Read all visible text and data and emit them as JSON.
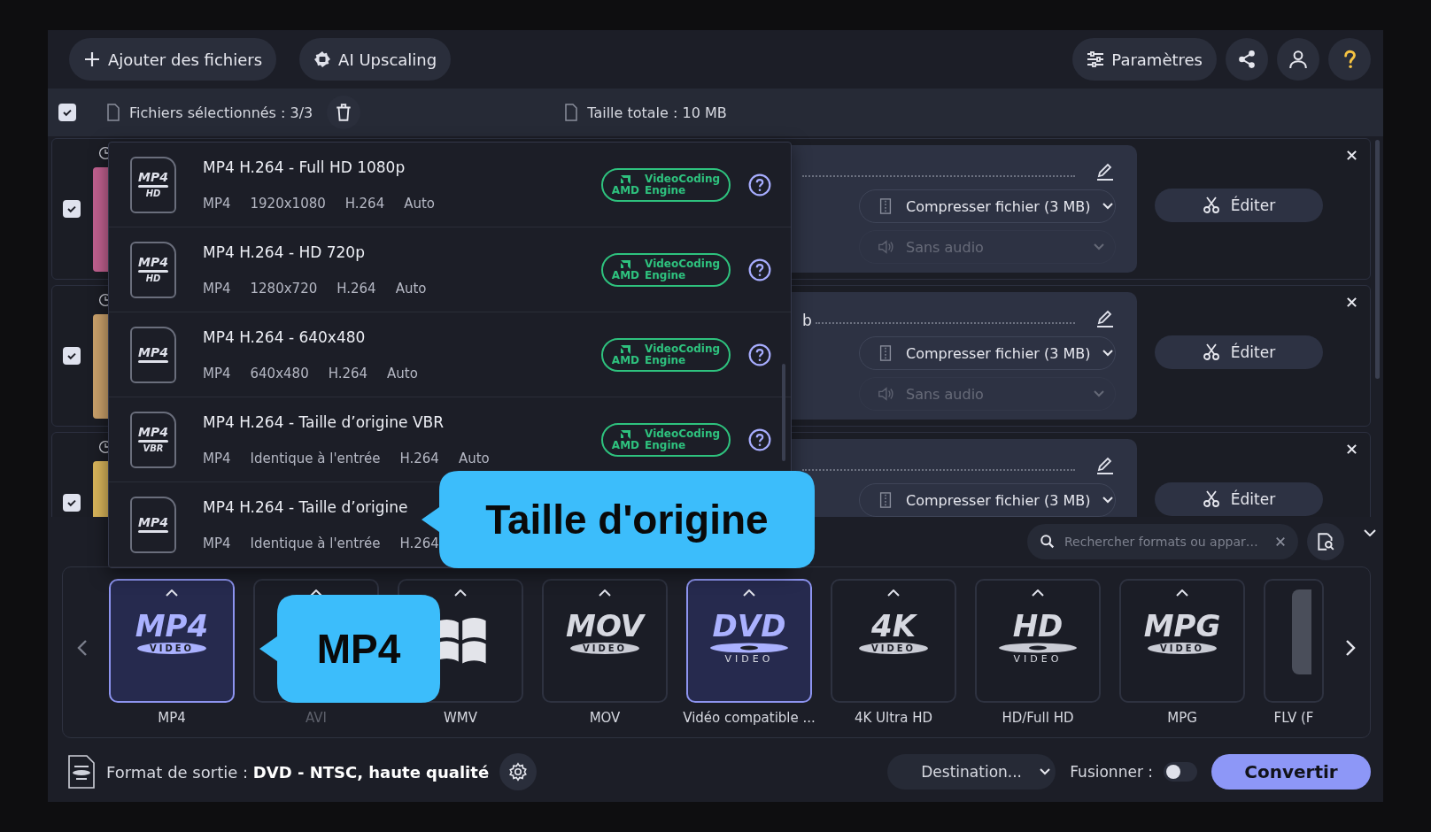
{
  "toolbar": {
    "add_button": "Ajouter des fichiers",
    "upscale_button": "AI Upscaling",
    "settings_button": "Paramètres"
  },
  "file_header": {
    "checked": true,
    "selected_files": "Fichiers sélectionnés : 3/3",
    "total_size": "Taille totale : 10 MB"
  },
  "files": [
    {
      "checked": true,
      "compress": "Compresser fichier (3 MB)",
      "audio": "Sans audio",
      "audio_disabled": true,
      "edit_button": "Éditer"
    },
    {
      "checked": true,
      "filename": "b",
      "compress": "Compresser fichier (3 MB)",
      "audio": "Sans audio",
      "audio_disabled": true,
      "edit_button": "Éditer"
    },
    {
      "checked": true,
      "compress": "Compresser fichier (3 MB)",
      "edit_button": "Éditer"
    }
  ],
  "format_menu": {
    "items": [
      {
        "icon_label": "MP4",
        "icon_sub": "HD",
        "title": "MP4 H.264 - Full HD 1080p",
        "specs": [
          "MP4",
          "1920x1080",
          "H.264",
          "Auto"
        ],
        "badge": {
          "brand": "AMD",
          "lines": [
            "VideoCoding",
            "Engine"
          ]
        }
      },
      {
        "icon_label": "MP4",
        "icon_sub": "HD",
        "title": "MP4 H.264 - HD 720p",
        "specs": [
          "MP4",
          "1280x720",
          "H.264",
          "Auto"
        ],
        "badge": {
          "brand": "AMD",
          "lines": [
            "VideoCoding",
            "Engine"
          ]
        }
      },
      {
        "icon_label": "MP4",
        "title": "MP4 H.264 - 640x480",
        "specs": [
          "MP4",
          "640x480",
          "H.264",
          "Auto"
        ],
        "badge": {
          "brand": "AMD",
          "lines": [
            "VideoCoding",
            "Engine"
          ]
        }
      },
      {
        "icon_label": "MP4",
        "icon_sub": "VBR",
        "title": "MP4 H.264 - Taille d’origine VBR",
        "specs": [
          "MP4",
          "Identique à l'entrée",
          "H.264",
          "Auto"
        ],
        "badge": {
          "brand": "AMD",
          "lines": [
            "VideoCoding",
            "Engine"
          ]
        }
      },
      {
        "icon_label": "MP4",
        "title": "MP4 H.264 - Taille d’origine",
        "specs": [
          "MP4",
          "Identique à l'entrée",
          "H.264"
        ]
      }
    ]
  },
  "callouts": [
    {
      "kind": "menu",
      "text": "Taille d'origine"
    },
    {
      "kind": "tile",
      "text": "MP4"
    }
  ],
  "format_panel": {
    "search_placeholder": "Rechercher formats ou appar…",
    "tiles": [
      {
        "kind": "text",
        "logo": "MP4",
        "logo_sub": "VIDEO",
        "label": "MP4",
        "selected": true,
        "disabled": false
      },
      {
        "kind": "hidden",
        "label": "AVI",
        "selected": false,
        "disabled": true
      },
      {
        "kind": "windows",
        "label": "WMV",
        "selected": false,
        "disabled": false
      },
      {
        "kind": "text",
        "logo": "MOV",
        "logo_sub": "VIDEO",
        "label": "MOV",
        "selected": false,
        "disabled": false
      },
      {
        "kind": "disc",
        "logo": "DVD",
        "logo_sub": "VIDEO",
        "label": "Vidéo compatible ...",
        "selected": true,
        "disabled": false
      },
      {
        "kind": "text",
        "logo": "4K",
        "logo_sub": "VIDEO",
        "label": "4K Ultra HD",
        "selected": false,
        "disabled": false
      },
      {
        "kind": "disc",
        "logo": "HD",
        "logo_sub": "VIDEO",
        "label": "HD/Full HD",
        "selected": false,
        "disabled": false
      },
      {
        "kind": "text",
        "logo": "MPG",
        "logo_sub": "VIDEO",
        "label": "MPG",
        "selected": false,
        "disabled": false
      },
      {
        "kind": "partial",
        "label": "FLV (F",
        "selected": false,
        "disabled": false
      }
    ]
  },
  "output": {
    "format_label": "Format de sortie : **DVD - NTSC, haute qualité**",
    "destination": "Destination...",
    "merge_label": "Fusionner :",
    "merge_on": false,
    "convert_button": "Convertir"
  }
}
